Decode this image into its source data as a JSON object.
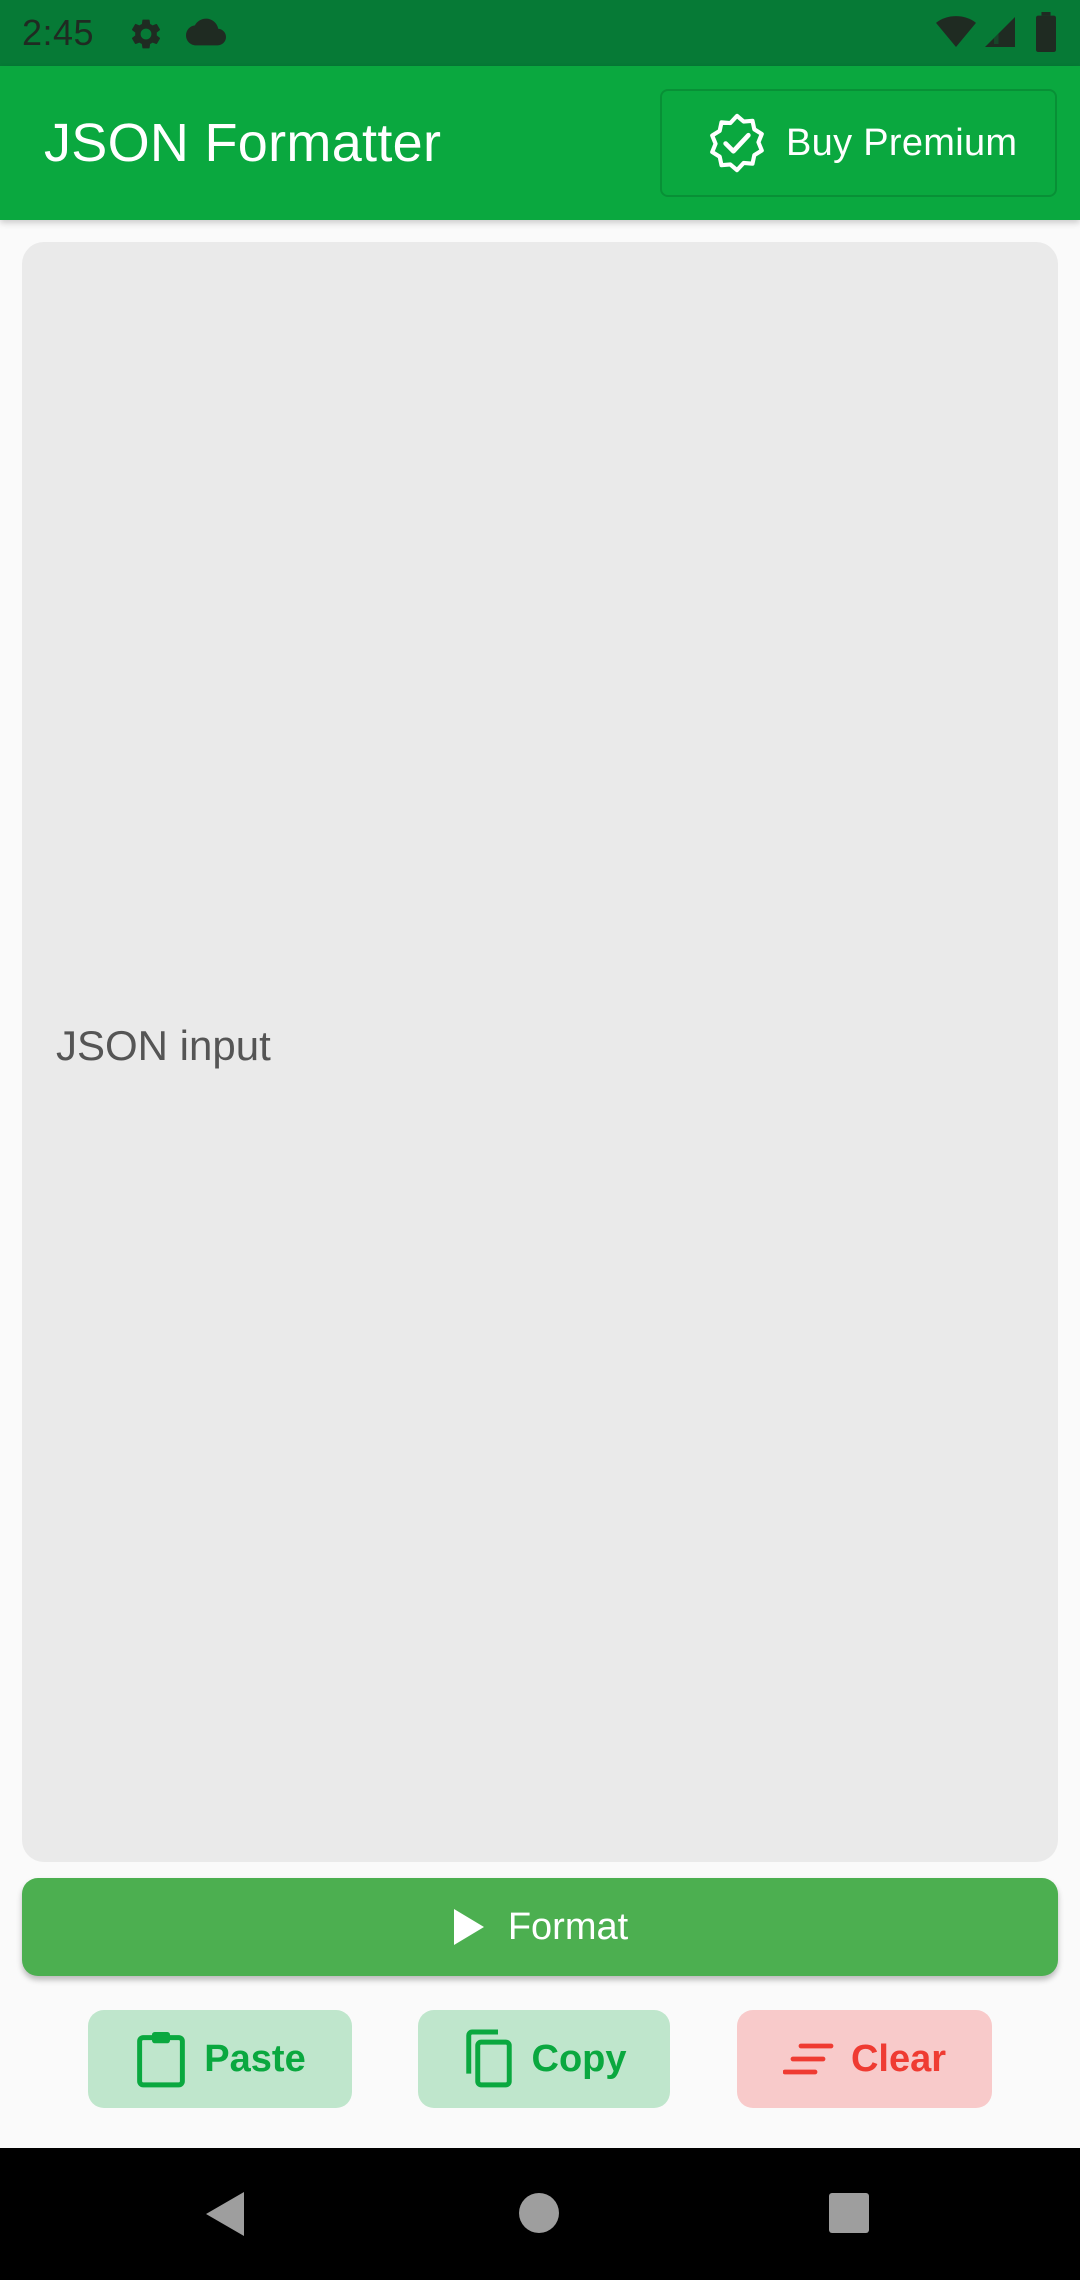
{
  "status_bar": {
    "time": "2:45",
    "icons": [
      "gear-icon",
      "cloud-icon",
      "wifi-icon",
      "cellular-signal-icon",
      "battery-icon"
    ]
  },
  "app_bar": {
    "title": "JSON Formatter",
    "premium_button_label": "Buy Premium",
    "premium_icon": "verified-badge-icon"
  },
  "input": {
    "placeholder": "JSON input",
    "value": ""
  },
  "format_button": {
    "label": "Format",
    "icon": "play-icon"
  },
  "actions": [
    {
      "label": "Paste",
      "icon": "clipboard-icon"
    },
    {
      "label": "Copy",
      "icon": "copy-icon"
    },
    {
      "label": "Clear",
      "icon": "clear-lines-icon"
    }
  ],
  "navigation": [
    "back-icon",
    "home-icon",
    "recents-icon"
  ],
  "colors": {
    "primary": "#0AA83F",
    "primary_dark": "#067A36",
    "format_button": "#4CAF50",
    "action_green_bg": "#BFE6CC",
    "action_red_bg": "#F8CACA",
    "clear_red": "#EF3B32",
    "input_bg": "#EAEAEA"
  }
}
